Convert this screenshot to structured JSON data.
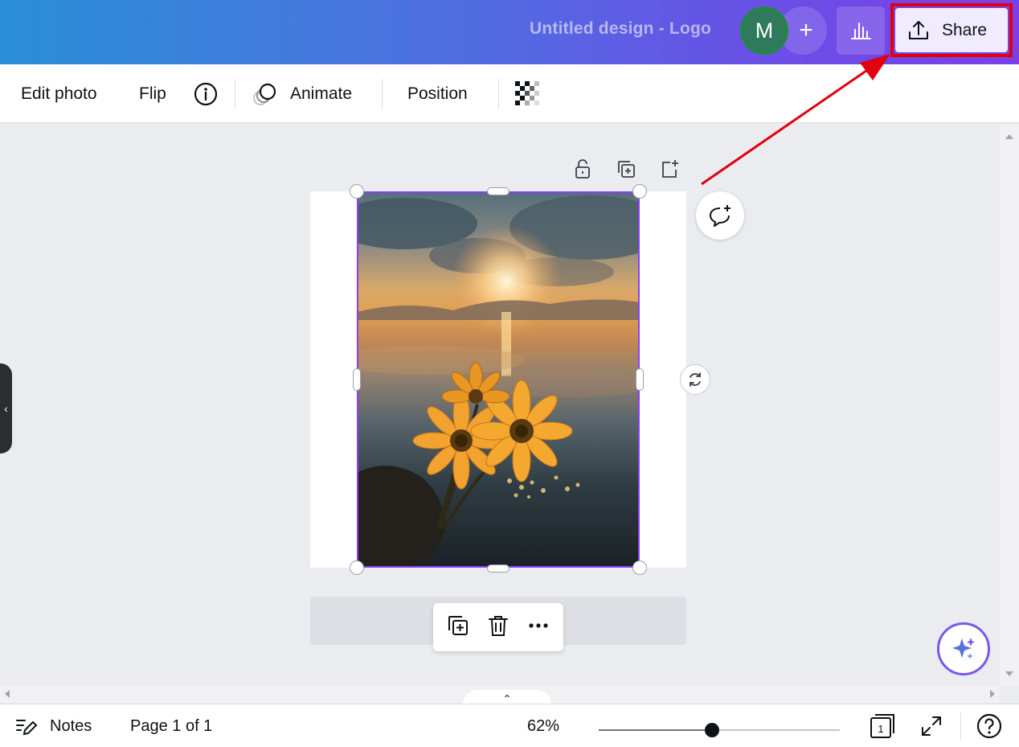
{
  "header": {
    "doc_title": "Untitled design - Logo",
    "avatar_initial": "M",
    "add_people_label": "+",
    "share_label": "Share"
  },
  "toolbar": {
    "edit_photo": "Edit photo",
    "flip": "Flip",
    "animate": "Animate",
    "position": "Position"
  },
  "canvas": {
    "collapse_glyph": "‹",
    "page_toggle_glyph": "⌃"
  },
  "footer": {
    "notes": "Notes",
    "page_indicator": "Page 1 of 1",
    "zoom": "62%",
    "zoom_fraction": 0.47,
    "page_count_badge": "1"
  },
  "colors": {
    "accent": "#8b3dff",
    "annotation": "#e0000f"
  }
}
